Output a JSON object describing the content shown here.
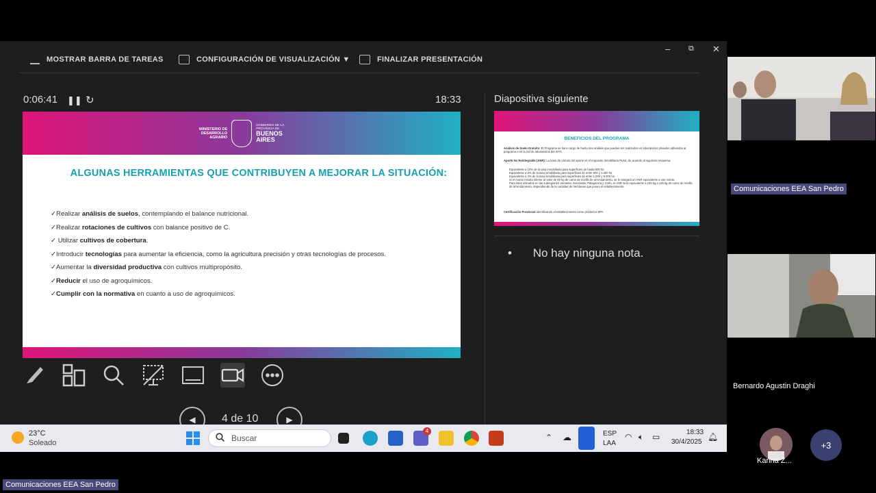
{
  "toolbar": {
    "show_taskbar": "MOSTRAR BARRA DE TAREAS",
    "display_settings": "CONFIGURACIÓN DE VISUALIZACIÓN ▼",
    "end_presentation": "FINALIZAR PRESENTACIÓN",
    "minimize": "–",
    "restore": "⧉",
    "close": "✕"
  },
  "timer": "0:06:41",
  "clock": "18:33",
  "current_slide": {
    "logo_left": [
      "MINISTERIO DE",
      "DESARROLLO",
      "AGRARIO"
    ],
    "logo_right_small": [
      "GOBIERNO DE LA",
      "PROVINCIA DE"
    ],
    "logo_right_big": [
      "BUENOS",
      "AIRES"
    ],
    "title": "ALGUNAS HERRAMIENTAS QUE CONTRIBUYEN A MEJORAR LA SITUACIÓN:",
    "items": [
      {
        "pre": "✓Realizar ",
        "bold": "análisis de suelos",
        "post": ", contemplando el balance nutricional."
      },
      {
        "pre": "✓Realizar ",
        "bold": "rotaciones de cultivos",
        "post": " con balance positivo de C."
      },
      {
        "pre": "✓  Utilizar ",
        "bold": "cultivos de cobertura",
        "post": "."
      },
      {
        "pre": "✓Introducir ",
        "bold": "tecnologías",
        "post": " para aumentar la eficiencia, como la agricultura precisión y otras tecnologías de procesos."
      },
      {
        "pre": "✓Aumentar la ",
        "bold": "diversidad productiva",
        "post": " con cultivos multipropósito."
      },
      {
        "pre": "✓",
        "bold": "Reducir",
        "post": " el uso de agroquímicos."
      },
      {
        "pre": "✓",
        "bold": "Cumplir con la normativa",
        "post": " en cuanto a uso de agroquimicos."
      }
    ]
  },
  "page": {
    "counter": "4 de 10"
  },
  "next": {
    "label": "Diapositiva siguiente",
    "title": "BENEFICIOS DEL PROGRAMA",
    "p1_bold": "Análisis de Suelo Gratuito:",
    "p1": " El Programa se hace cargo de hasta tres análisis que puedan ser realizados en laboratorios privados adheridos al programa o en la red de laboratorios del INTA.",
    "p2_bold": "Aporte No Reintegrable (ANR):",
    "p2": " La base de cálculo del aporte es el Impuesto Inmobiliario Rural, de acuerdo al siguiente esquema:",
    "bullets": [
      "Equivalente a 10% de la tasa inmobiliaria para superficies de hasta 600 ha",
      "Equivalente a 6% de la tasa inmobiliaria para superficies de entre 600 y 1.000 ha",
      "Equivalente a 3% de la tasa inmobiliaria para superficies de entre 1.000 y 5.000 ha",
      "Si el monto resulta inferior al valor de 80 kg de carne de novillo de arrendamiento, se le otorgará un ANR equivalente a ese monto.",
      "Para lotes ubicados en las subregiones Ventania, Semiárida, Patagónica y Corfo, el ANR será equivalente a 100 kg a 125 kg de carne de novillo de arrendamiento, dependiendo de la cantidad de hectáreas que posea el establecimiento."
    ],
    "p3_bold": "Certificación Provincial",
    "p3": " identificando al establecimiento como productor BPA."
  },
  "notes": {
    "bullet": "•",
    "text": "No hay ninguna nota."
  },
  "taskbar": {
    "weather_temp": "23°C",
    "weather_desc": "Soleado",
    "search": "Buscar",
    "teams_badge": "4",
    "lang1": "ESP",
    "lang2": "LAA",
    "time": "18:33",
    "date": "30/4/2025"
  },
  "gallery": {
    "tag1": "Comunicaciones EEA San Pedro",
    "name2": "Bernardo Agustin Draghi",
    "avatar_name": "Karina Z...",
    "more": "+3",
    "bottom_tag": "Comunicaciones EEA San Pedro"
  },
  "colors": {
    "accent_teal": "#16a0b0",
    "band_pink": "#e0157a",
    "band_cyan": "#1fb0c4"
  }
}
